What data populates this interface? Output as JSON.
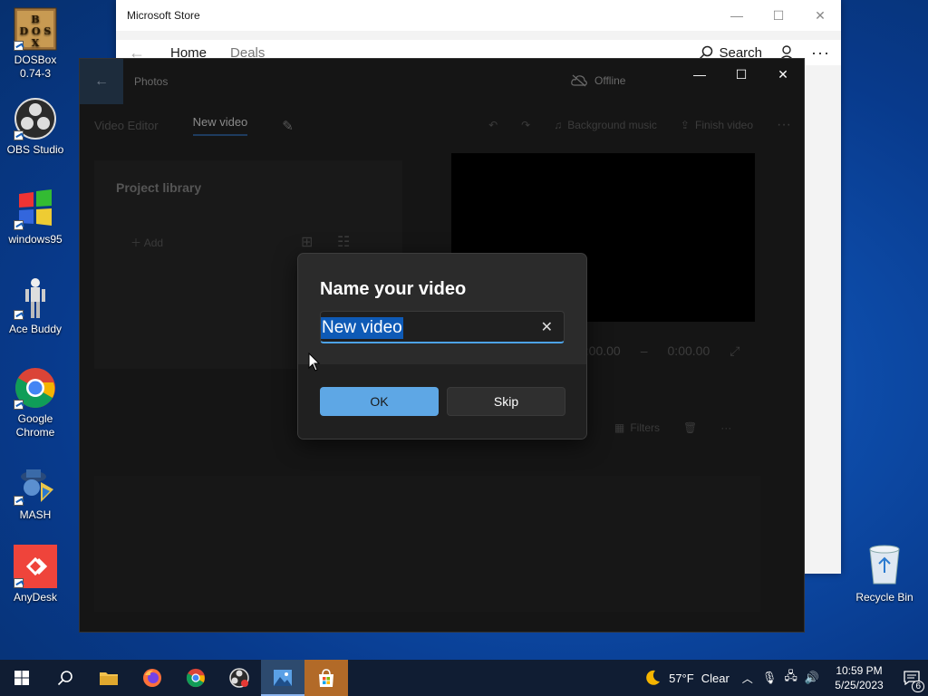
{
  "desktop": {
    "icons": [
      {
        "label": "DOSBox\n0.74-3"
      },
      {
        "label": "OBS Studio"
      },
      {
        "label": "windows95"
      },
      {
        "label": "Ace Buddy"
      },
      {
        "label": "Google\nChrome"
      },
      {
        "label": "MASH"
      },
      {
        "label": "AnyDesk"
      }
    ],
    "recycle_bin": "Recycle Bin",
    "dosbox_logo": "DOS BOX"
  },
  "store": {
    "title": "Microsoft Store",
    "nav": {
      "home": "Home",
      "deals": "Deals",
      "search": "Search"
    }
  },
  "photos": {
    "app_title": "Photos",
    "status": "Offline",
    "tabs": {
      "editor": "Video Editor",
      "current": "New video"
    },
    "toolbar": {
      "background_music": "Background music",
      "finish": "Finish video"
    },
    "library": {
      "title": "Project library",
      "add": "Add"
    },
    "timeline": {
      "current": "0:00.00",
      "total": "0:00.00"
    },
    "storyboard": {
      "filters": "Filters"
    }
  },
  "dialog": {
    "title": "Name your video",
    "input_value": "New video",
    "ok_label": "OK",
    "skip_label": "Skip"
  },
  "taskbar": {
    "weather": {
      "temp": "57°F",
      "condition": "Clear"
    },
    "clock": {
      "time": "10:59 PM",
      "date": "5/25/2023"
    },
    "notifications": "6"
  },
  "colors": {
    "accent": "#5ea7e5",
    "selection": "#0e5ab6",
    "taskbar": "#101d33"
  }
}
